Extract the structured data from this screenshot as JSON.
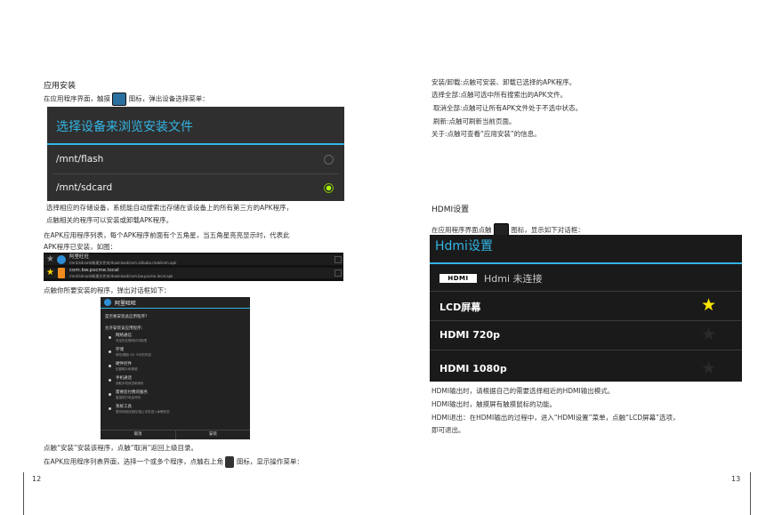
{
  "left": {
    "heading": "应用安装",
    "intro_before": "在应用程序界面，触摸",
    "intro_after": "图标，弹出设备选择菜单：",
    "chooser": {
      "title": "选择设备来浏览安装文件",
      "options": [
        {
          "label": "/mnt/flash",
          "selected": false
        },
        {
          "label": "/mnt/sdcard",
          "selected": true
        }
      ]
    },
    "para1_line1": "选择相应的存储设备，系统能自动搜索出存储在该设备上的所有第三方的APK程序，",
    "para1_line2": "点触相关的程序可以安装或卸载APK程序。",
    "para2_line1": "在APK应用程序列表，每个APK程序前面有个五角星，当五角星亮亮显示时，代表此",
    "para2_line2": "APK程序已安装，如图：",
    "apk_list": [
      {
        "name": "阿里旺旺",
        "path": "/mnt/sdcard/新建文件夹/download/com.alibaba.mobileim.apk",
        "installed": false
      },
      {
        "name": "com.bw.pxcme.local",
        "path": "/mnt/sdcard/新建文件夹/download/com.bw.pxcme.local.apk",
        "installed": true
      }
    ],
    "para3": "点触你所要安装的程序，弹出对话框如下：",
    "install_dialog": {
      "app_name": "阿里旺旺",
      "question": "是否要安装此应用程序？",
      "allow": "允许安装该应用程序：",
      "permissions": [
        {
          "name": "网络通信",
          "desc": "完全的互联网访问权限"
        },
        {
          "name": "存储",
          "desc": "修改/删除 SD 卡中的内容"
        },
        {
          "name": "硬件控件",
          "desc": "拍摄照片和视频"
        },
        {
          "name": "手机通话",
          "desc": "读取手机状态和身份"
        },
        {
          "name": "需要您付费的服务",
          "desc": "直接拨打电话号码"
        },
        {
          "name": "系统工具",
          "desc": "更改网络连接性/阻止手机进入休眠状态"
        }
      ],
      "cancel": "取消",
      "install": "安装"
    },
    "para4": "点触“安装”安装该程序，点触“取消”返回上级目录。",
    "para5_before": "在APK应用程序列表界面，选择一个或多个程序，点触右上角",
    "para5_after": "图标，显示操作菜单：",
    "page_number": "12"
  },
  "right": {
    "menu_lines": [
      "安装/卸载:点触可安装、卸载已选择的APK程序。",
      "选择全部:点触可选中所有搜索出的APK文件。",
      "取消全部:点触可让所有APK文件处于不选中状态。",
      "刷新:点触可刷新当前页面。",
      "关于:点触可查看“应用安装”的信息。"
    ],
    "heading": "HDMI设置",
    "intro_before": "在应用程序界面点触",
    "intro_after": "图标，显示如下对话框：",
    "hdmi_dialog": {
      "title": "Hdmi设置",
      "logo": "HDMI",
      "status": "Hdmi 未连接",
      "options": [
        {
          "label": "LCD屏幕",
          "starred": true
        },
        {
          "label": "HDMI 720p",
          "starred": false
        },
        {
          "label": "HDMI 1080p",
          "starred": false
        }
      ]
    },
    "para1": "HDMI输出时，请根据自己的需要选择相近的HDMI输出模式。",
    "para2": "HDMI输出时，触摸屏有触摸鼠标的功能。",
    "para3_line1": "HDMI退出：在HDMI输出的过程中，进入“HDMI设置”菜单，点触“LCD屏幕”选项，",
    "para3_line2": "即可退出。",
    "page_number": "13"
  },
  "colors": {
    "accent": "#33b5e5",
    "radio_on": "#aaff00",
    "star_on": "#ffe600"
  }
}
